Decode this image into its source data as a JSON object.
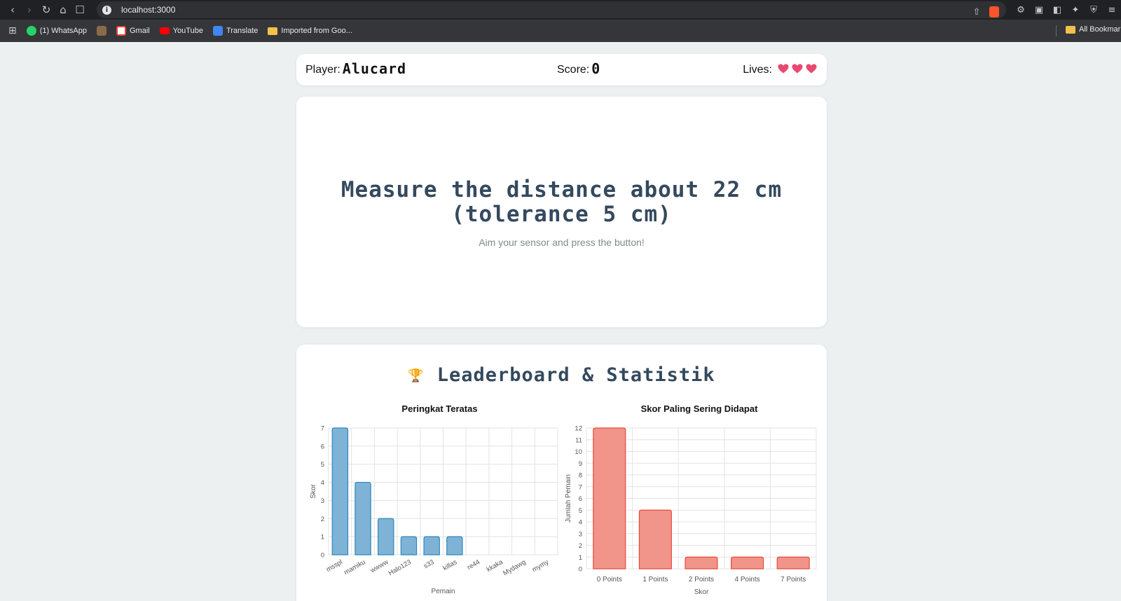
{
  "browser": {
    "url": "localhost:3000",
    "bookmarks": [
      {
        "label": "(1) WhatsApp",
        "icon": "whatsapp-icon",
        "color": "#25d366"
      },
      {
        "label": "",
        "icon": "site-icon",
        "color": "#8a6a4a"
      },
      {
        "label": "Gmail",
        "icon": "gmail-icon",
        "color": "#ea4335"
      },
      {
        "label": "YouTube",
        "icon": "youtube-icon",
        "color": "#ff0000"
      },
      {
        "label": "Translate",
        "icon": "translate-icon",
        "color": "#4285f4"
      },
      {
        "label": "Imported from Goo...",
        "icon": "folder-icon",
        "color": "#f2c04c"
      }
    ],
    "all_bookmarks": "All Bookmarks"
  },
  "game": {
    "player_label": "Player:",
    "player_name": "Alucard",
    "score_label": "Score:",
    "score_value": "0",
    "lives_label": "Lives:",
    "lives": 3,
    "heart_color": "#e84a6f"
  },
  "mission": {
    "title": "Measure the distance about 22 cm (tolerance 5 cm)",
    "subtitle": "Aim your sensor and press the button!"
  },
  "leaderboard": {
    "title": "Leaderboard & Statistik",
    "trophy_icon": "trophy-icon"
  },
  "chart_data": [
    {
      "type": "bar",
      "title": "Peringkat Teratas",
      "xlabel": "Pemain",
      "ylabel": "Skor",
      "categories": [
        "msspl",
        "mamiku",
        "wwww",
        "Halo123",
        "s33",
        "killas",
        "re44",
        "kkaka",
        "Mydawg",
        "mymy"
      ],
      "values": [
        7,
        4,
        2,
        1,
        1,
        1,
        0,
        0,
        0,
        0
      ],
      "ylim": [
        0,
        7
      ],
      "yticks": [
        0,
        1,
        2,
        3,
        4,
        5,
        6,
        7
      ],
      "grid": true,
      "color": "#7fb3d5",
      "border": "#2e86c1"
    },
    {
      "type": "bar",
      "title": "Skor Paling Sering Didapat",
      "xlabel": "Skor",
      "ylabel": "Jumlah Pemain",
      "categories": [
        "0 Points",
        "1 Points",
        "2 Points",
        "4 Points",
        "7 Points"
      ],
      "values": [
        12,
        5,
        1,
        1,
        1
      ],
      "ylim": [
        0,
        12
      ],
      "yticks": [
        0,
        1,
        2,
        3,
        4,
        5,
        6,
        7,
        8,
        9,
        10,
        11,
        12
      ],
      "grid": true,
      "color": "#f1948a",
      "border": "#e74c3c"
    }
  ]
}
